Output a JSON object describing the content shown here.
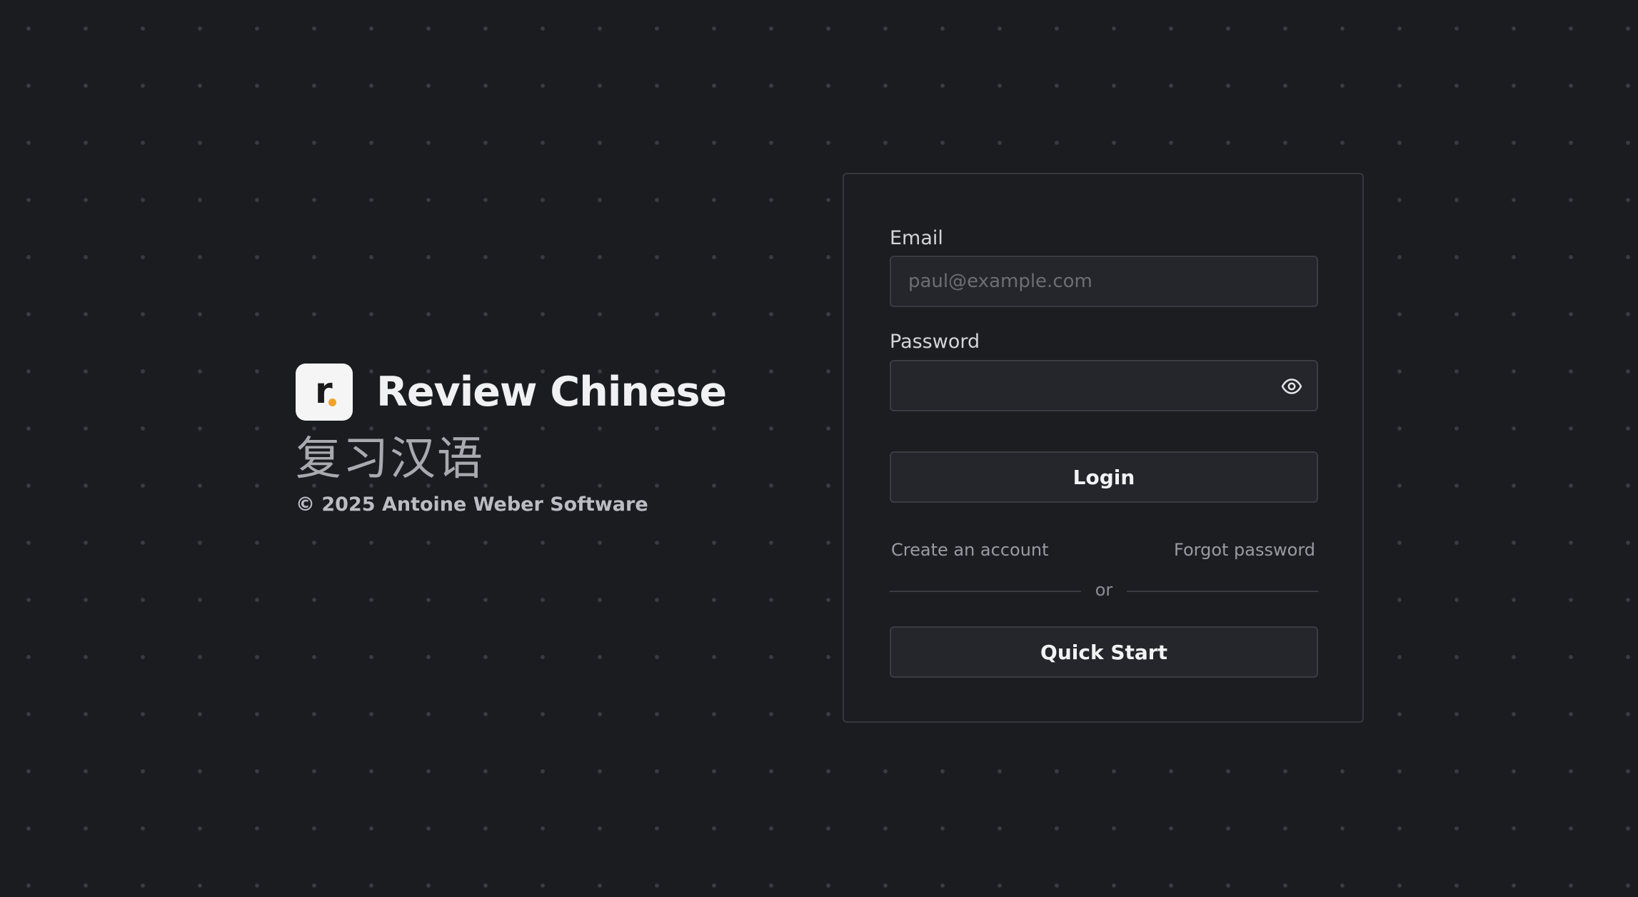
{
  "brand": {
    "logo_letter": "r",
    "name": "Review Chinese",
    "chinese_name": "复习汉语",
    "copyright": "© 2025 Antoine Weber Software",
    "logo_accent_color": "#f0a32a"
  },
  "login_form": {
    "email_label": "Email",
    "email_placeholder": "paul@example.com",
    "email_value": "",
    "password_label": "Password",
    "password_value": "",
    "password_toggle_icon": "eye-icon",
    "login_button": "Login",
    "create_account_link": "Create an account",
    "forgot_password_link": "Forgot password",
    "divider_text": "or",
    "quick_start_button": "Quick Start"
  },
  "theme": {
    "background": "#1b1c20",
    "card_background": "#1c1d21",
    "input_background": "#25262b",
    "border": "#3a3c42"
  }
}
